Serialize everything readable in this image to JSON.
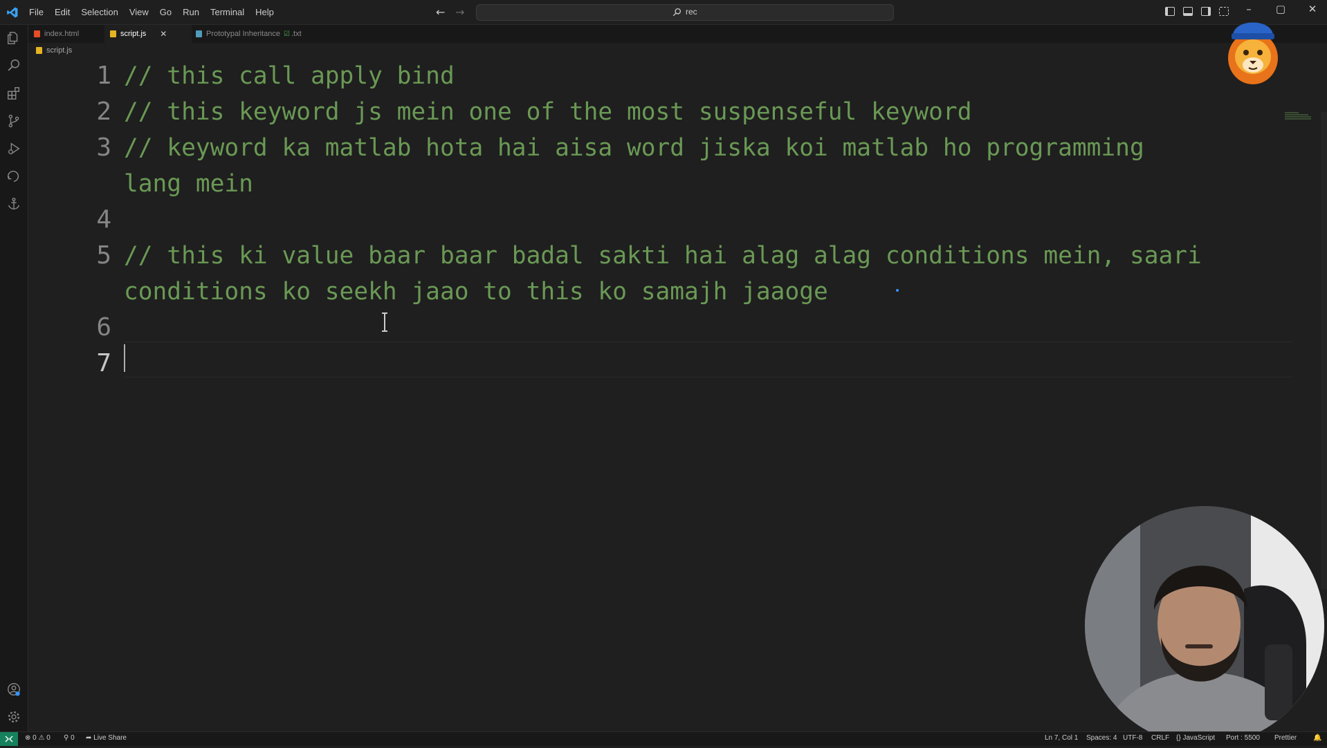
{
  "menu": {
    "items": [
      "File",
      "Edit",
      "Selection",
      "View",
      "Go",
      "Run",
      "Terminal",
      "Help"
    ]
  },
  "command_center": {
    "text": "rec"
  },
  "tabs": [
    {
      "label": "index.html",
      "icon": "html-file-icon",
      "color": "#e44d26"
    },
    {
      "label": "script.js",
      "icon": "js-file-icon",
      "color": "#e6b422",
      "active": true
    },
    {
      "label": "Prototypal Inheritance",
      "icon": "text-file-icon",
      "color": "#519aba",
      "badge": "☑",
      "ext": ".txt"
    }
  ],
  "breadcrumb": {
    "file": "script.js"
  },
  "editor": {
    "line_numbers": [
      "1",
      "2",
      "3",
      "4",
      "5",
      "6",
      "7"
    ],
    "lines": [
      "// this call apply bind",
      "// this keyword js mein one of the most suspenseful keyword",
      "// keyword ka matlab hota hai aisa word jiska koi matlab ho programming",
      "lang mein",
      "// this ki value baar baar badal sakti hai alag alag conditions mein, saari",
      "conditions ko seekh jaao to this ko samajh jaaoge"
    ],
    "comment_color": "#6a9955"
  },
  "statusbar": {
    "problems": "⊗ 0 ⚠ 0",
    "ports": "⚲ 0",
    "live_share": "Live Share",
    "position": "Ln 7, Col 1",
    "spaces": "Spaces: 4",
    "encoding": "UTF-8",
    "eol": "CRLF",
    "language": "{} JavaScript",
    "port": "Port : 5500",
    "prettier": "Prettier",
    "accent": "#16825d"
  }
}
